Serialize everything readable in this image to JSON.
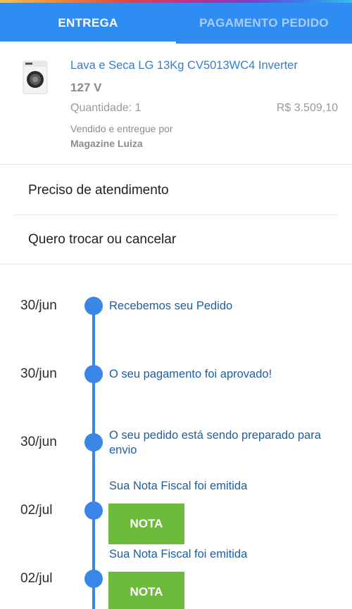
{
  "tabs": [
    {
      "label": "ENTREGA",
      "active": true
    },
    {
      "label": "PAGAMENTO PEDIDO",
      "active": false
    }
  ],
  "product": {
    "title": "Lava e Seca LG 13Kg CV5013WC4 Inverter",
    "voltage": "127 V",
    "quantity": "Quantidade: 1",
    "price": "R$ 3.509,10",
    "sold_by": "Vendido e entregue por",
    "seller": "Magazine Luiza",
    "image_icon": "washing-machine-icon"
  },
  "menu": [
    {
      "label": "Preciso de atendimento"
    },
    {
      "label": "Quero trocar ou cancelar"
    }
  ],
  "timeline": [
    {
      "date": "30/jun",
      "text": "Recebemos seu Pedido"
    },
    {
      "date": "30/jun",
      "text": "O seu pagamento foi aprovado!"
    },
    {
      "date": "30/jun",
      "text": "O seu pedido está sendo preparado para envio"
    },
    {
      "date": "02/jul",
      "text": "Sua Nota Fiscal foi emitida",
      "button": "NOTA"
    },
    {
      "date": "02/jul",
      "text": "Sua Nota Fiscal foi emitida",
      "button": "NOTA"
    }
  ],
  "colors": {
    "header_blue": "#2f8cf3",
    "link_blue": "#2f7fd6",
    "timeline_blue": "#3a86e8",
    "button_green": "#6dbb3a"
  }
}
